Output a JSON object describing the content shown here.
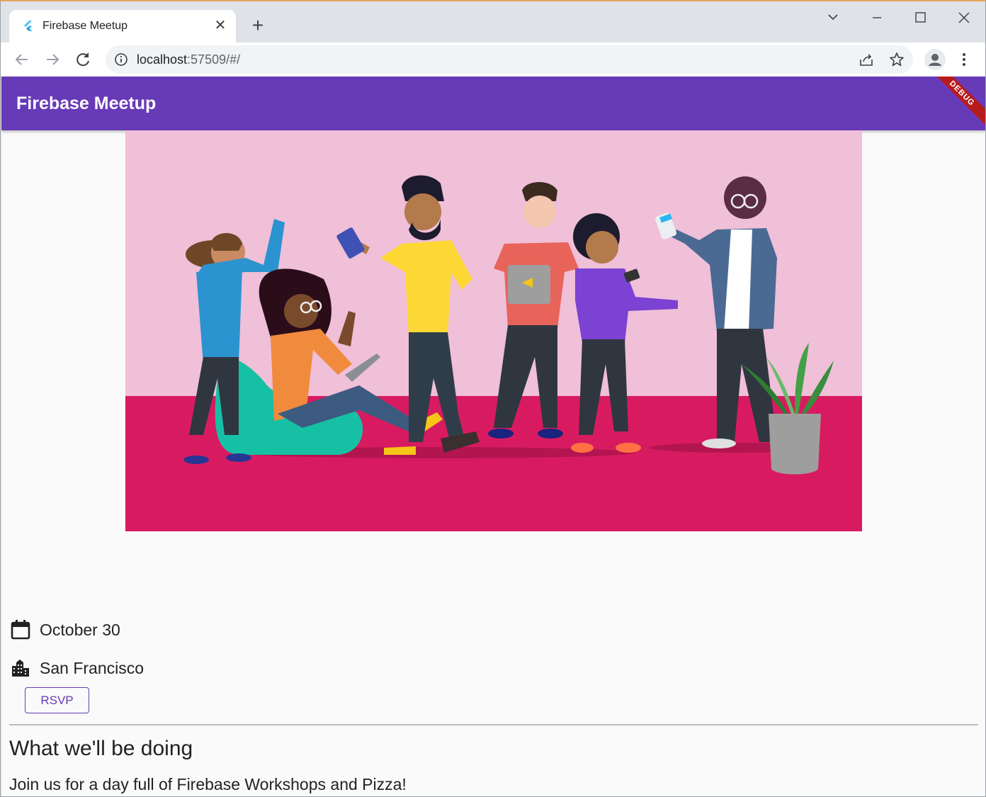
{
  "browser": {
    "tab_title": "Firebase Meetup",
    "new_tab": "+",
    "url_host": "localhost",
    "url_rest": ":57509/#/"
  },
  "app": {
    "title": "Firebase Meetup",
    "debug_banner": "DEBUG",
    "date": "October 30",
    "location": "San Francisco",
    "rsvp_label": "RSVP",
    "section_title": "What we'll be doing",
    "section_body": "Join us for a day full of Firebase Workshops and Pizza!"
  },
  "colors": {
    "appbar": "#673ab7",
    "hero_wall": "#f0bfd8",
    "hero_floor": "#d81b60"
  }
}
